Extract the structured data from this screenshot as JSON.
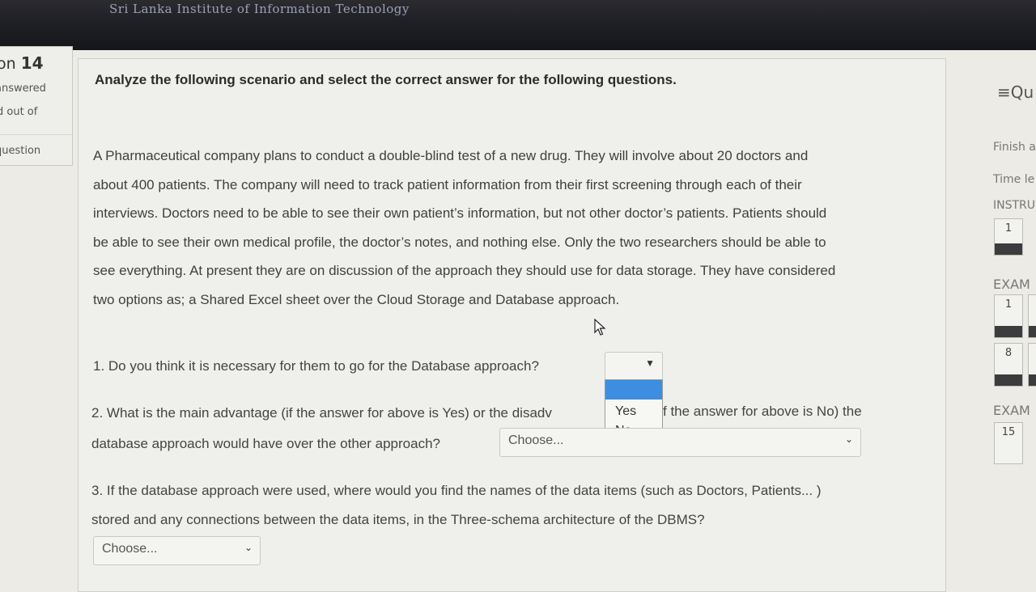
{
  "header": {
    "institution": "Sri Lanka Institute of Information Technology"
  },
  "question_info": {
    "number_prefix": "on",
    "number": "14",
    "status": "answered",
    "marked": "d out of",
    "flag": "question"
  },
  "question": {
    "heading": "Analyze the following scenario and select the correct answer for the following questions.",
    "scenario_lines": [
      "A Pharmaceutical company plans to conduct a double-blind test of a new drug. They will involve about 20 doctors and",
      "about 400 patients. The company will need to track patient information from their first screening through each of their",
      "interviews. Doctors need to be able to see their own patient’s information, but not other doctor’s patients. Patients should",
      "be able to see their own medical profile, the doctor’s notes, and nothing else. Only the two researchers should be able to",
      "see everything. At present they are on discussion of the approach they should use for data storage. They have considered",
      "two options as; a Shared Excel sheet over the Cloud Storage and Database approach."
    ],
    "q1": "1. Do you think it is necessary for them to go for the Database approach?",
    "q2_part1": "2. What is the main advantage (if the answer for above is Yes) or the disadv",
    "q2_part1_tail": "f the answer for above is No) the",
    "q2_part2": "database approach would have over the other approach?",
    "q3_part1": "3. If the database approach were used, where would you find the names of the data items (such as Doctors, Patients... )",
    "q3_part2": "stored and any connections between the data items, in the Three-schema architecture of the DBMS?"
  },
  "selects": {
    "q1": {
      "value": "",
      "options": [
        "",
        "Yes",
        "No"
      ],
      "open": true
    },
    "q2": {
      "value": "Choose..."
    },
    "q3": {
      "value": "Choose..."
    }
  },
  "navigation": {
    "title": "Qu",
    "finish": "Finish a",
    "time_left": "Time le",
    "instructions": "INSTRU",
    "instr_items": [
      "1"
    ],
    "exam1_label": "EXAM",
    "exam1_items": [
      "1",
      "8"
    ],
    "exam2_label": "EXAM",
    "exam2_items": [
      "15"
    ]
  },
  "colors": {
    "highlight": "#3d8ee0",
    "topbar": "#1e1f24"
  }
}
